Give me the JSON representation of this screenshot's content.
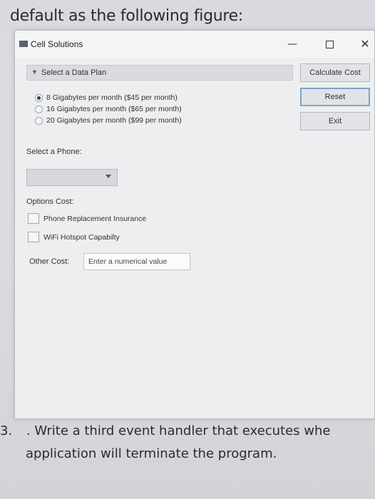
{
  "page": {
    "heading": "default as the following figure:",
    "step_number": "3.",
    "step_text_line1": ". Write a third event handler that executes whe",
    "step_text_line2": "application will terminate the program."
  },
  "window": {
    "title": "Cell Solutions",
    "controls": {
      "minimize": "—",
      "close": "✕"
    },
    "data_plan": {
      "header": "Select a Data Plan",
      "options": [
        {
          "label": "8 Gigabytes per month ($45 per month)",
          "selected": true
        },
        {
          "label": "16 Gigabytes per month ($65 per month)",
          "selected": false
        },
        {
          "label": "20 Gigabytes per month ($99 per month)",
          "selected": false
        }
      ]
    },
    "buttons": {
      "calculate": "Calculate Cost",
      "reset": "Reset",
      "exit": "Exit"
    },
    "phone": {
      "label": "Select a Phone:",
      "selected_value": ""
    },
    "options_cost": {
      "label": "Options Cost:",
      "items": [
        {
          "label": "Phone Replacement Insurance",
          "checked": false
        },
        {
          "label": "WiFi Hotspot Capabilty",
          "checked": false
        }
      ]
    },
    "other_cost": {
      "label": "Other Cost:",
      "placeholder": "Enter a numerical value"
    }
  }
}
